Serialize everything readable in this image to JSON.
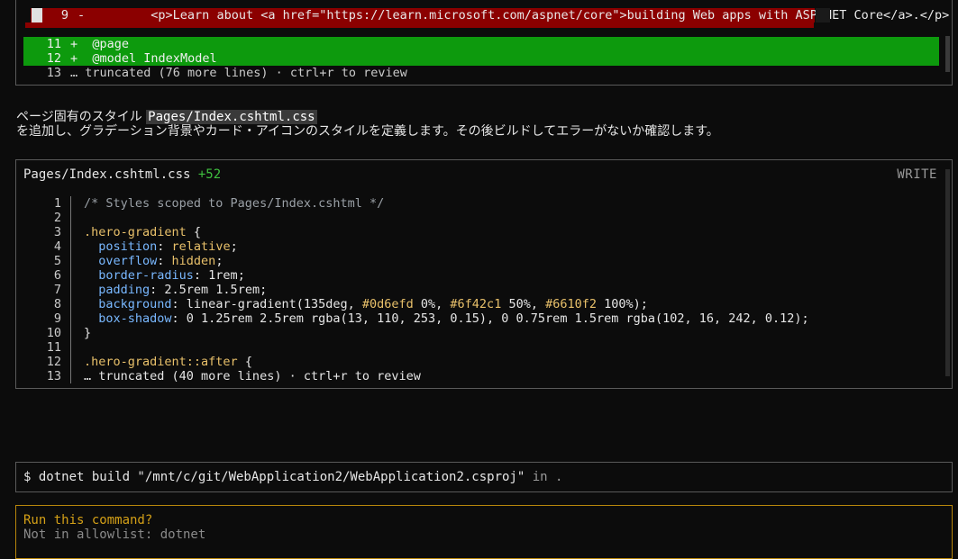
{
  "diff": {
    "lines": [
      {
        "num": "9",
        "sign": "-",
        "text": "    <p>Learn about <a href=\"https://learn.microsoft.com/aspnet/core\">building Web apps with ASP.NET Core</a>.</p>"
      },
      {
        "num": "11",
        "sign": "+",
        "text": "@page"
      },
      {
        "num": "12",
        "sign": "+",
        "text": "@model IndexModel"
      },
      {
        "num": "13",
        "sign": "",
        "text": "… truncated (76 more lines) · ctrl+r to review"
      }
    ]
  },
  "prose": {
    "line1_prefix": "ページ固有のスタイル ",
    "line1_path": "Pages/Index.cshtml.css",
    "line2": "を追加し、グラデーション背景やカード・アイコンのスタイルを定義します。その後ビルドしてエラーがないか確認します。"
  },
  "file": {
    "name": "Pages/Index.cshtml.css",
    "added": "+52",
    "mode": "WRITE",
    "lines": [
      {
        "num": "1",
        "parts": [
          {
            "t": "/* Styles scoped to Pages/Index.cshtml */",
            "c": "tok-comment"
          }
        ]
      },
      {
        "num": "2",
        "parts": []
      },
      {
        "num": "3",
        "parts": [
          {
            "t": ".hero-gradient",
            "c": "tok-sel"
          },
          {
            "t": " {",
            "c": "tok-text"
          }
        ]
      },
      {
        "num": "4",
        "parts": [
          {
            "t": "  position",
            "c": "tok-prop"
          },
          {
            "t": ": ",
            "c": "tok-text"
          },
          {
            "t": "relative",
            "c": "tok-val"
          },
          {
            "t": ";",
            "c": "tok-text"
          }
        ]
      },
      {
        "num": "5",
        "parts": [
          {
            "t": "  overflow",
            "c": "tok-prop"
          },
          {
            "t": ": ",
            "c": "tok-text"
          },
          {
            "t": "hidden",
            "c": "tok-val"
          },
          {
            "t": ";",
            "c": "tok-text"
          }
        ]
      },
      {
        "num": "6",
        "parts": [
          {
            "t": "  border-radius",
            "c": "tok-prop"
          },
          {
            "t": ": 1rem;",
            "c": "tok-text"
          }
        ]
      },
      {
        "num": "7",
        "parts": [
          {
            "t": "  padding",
            "c": "tok-prop"
          },
          {
            "t": ": 2.5rem 1.5rem;",
            "c": "tok-text"
          }
        ]
      },
      {
        "num": "8",
        "parts": [
          {
            "t": "  background",
            "c": "tok-prop"
          },
          {
            "t": ": linear-gradient(135deg, ",
            "c": "tok-text"
          },
          {
            "t": "#0d6efd",
            "c": "tok-val"
          },
          {
            "t": " 0%, ",
            "c": "tok-text"
          },
          {
            "t": "#6f42c1",
            "c": "tok-val"
          },
          {
            "t": " 50%, ",
            "c": "tok-text"
          },
          {
            "t": "#6610f2",
            "c": "tok-val"
          },
          {
            "t": " 100%);",
            "c": "tok-text"
          }
        ]
      },
      {
        "num": "9",
        "parts": [
          {
            "t": "  box-shadow",
            "c": "tok-prop"
          },
          {
            "t": ": 0 1.25rem 2.5rem rgba(13, 110, 253, 0.15), 0 0.75rem 1.5rem rgba(102, 16, 242, 0.12);",
            "c": "tok-text"
          }
        ]
      },
      {
        "num": "10",
        "parts": [
          {
            "t": "}",
            "c": "tok-text"
          }
        ]
      },
      {
        "num": "11",
        "parts": []
      },
      {
        "num": "12",
        "parts": [
          {
            "t": ".hero-gradient::after",
            "c": "tok-sel"
          },
          {
            "t": " {",
            "c": "tok-text"
          }
        ]
      },
      {
        "num": "13",
        "parts": [
          {
            "t": "… truncated (40 more lines) · ctrl+r to review",
            "c": "tok-text"
          }
        ]
      }
    ]
  },
  "command": {
    "prompt": "$ ",
    "text": "dotnet build \"/mnt/c/git/WebApplication2/WebApplication2.csproj\"",
    "suffix": " in ."
  },
  "approval": {
    "title": "Run this command?",
    "subtitle": "Not in allowlist: dotnet"
  }
}
